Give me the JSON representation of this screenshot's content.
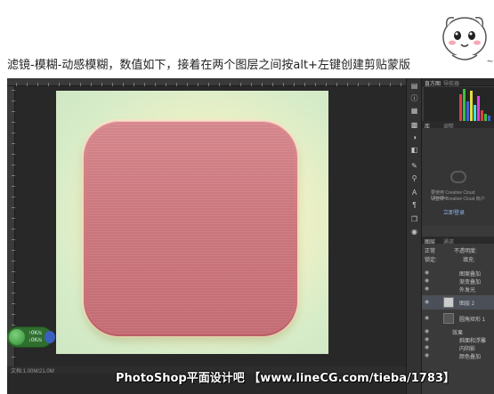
{
  "caption": "滤镜-模糊-动感模糊，数值如下，接着在两个图层之间按alt+左键创建剪贴蒙版",
  "caption_suffix": "~",
  "colors": {
    "icon_fill": "#cf7a80",
    "canvas_bg": "#eef0c6",
    "ps_bg": "#282828"
  },
  "status": "文档:1.00M/21.0M",
  "widget": {
    "up": "0K/s",
    "down": "0K/s"
  },
  "panels": {
    "histogram_tab": "直方图",
    "navigator_tab": "导航器",
    "libraries_tab": "库",
    "adjust_tab": "调整",
    "cloud_icon": "creative-cloud-icon",
    "libraries_text_1": "要使用 Creative Cloud Libraries",
    "libraries_text_2": "请登录 Creative Cloud 帐户",
    "libraries_link": "立即登录",
    "layers_tab": "图层",
    "channels_tab": "通道",
    "blend_mode": "正常",
    "opacity_label": "不透明度:",
    "lock_label": "锁定:",
    "fill_label": "填充:",
    "layers": [
      {
        "name": "图案叠加",
        "type": "effect"
      },
      {
        "name": "渐变叠加",
        "type": "effect"
      },
      {
        "name": "外发光",
        "type": "effect"
      },
      {
        "name": "图层 2",
        "type": "layer",
        "selected": true
      },
      {
        "name": "圆角矩形 1",
        "type": "shape"
      },
      {
        "name": "效果",
        "type": "effect"
      },
      {
        "name": "斜面和浮雕",
        "type": "effect"
      },
      {
        "name": "内阴影",
        "type": "effect"
      },
      {
        "name": "颜色叠加",
        "type": "effect"
      }
    ]
  },
  "watermark": "PhotoShop平面设计吧 【www.lineCG.com/tieba/1783】"
}
